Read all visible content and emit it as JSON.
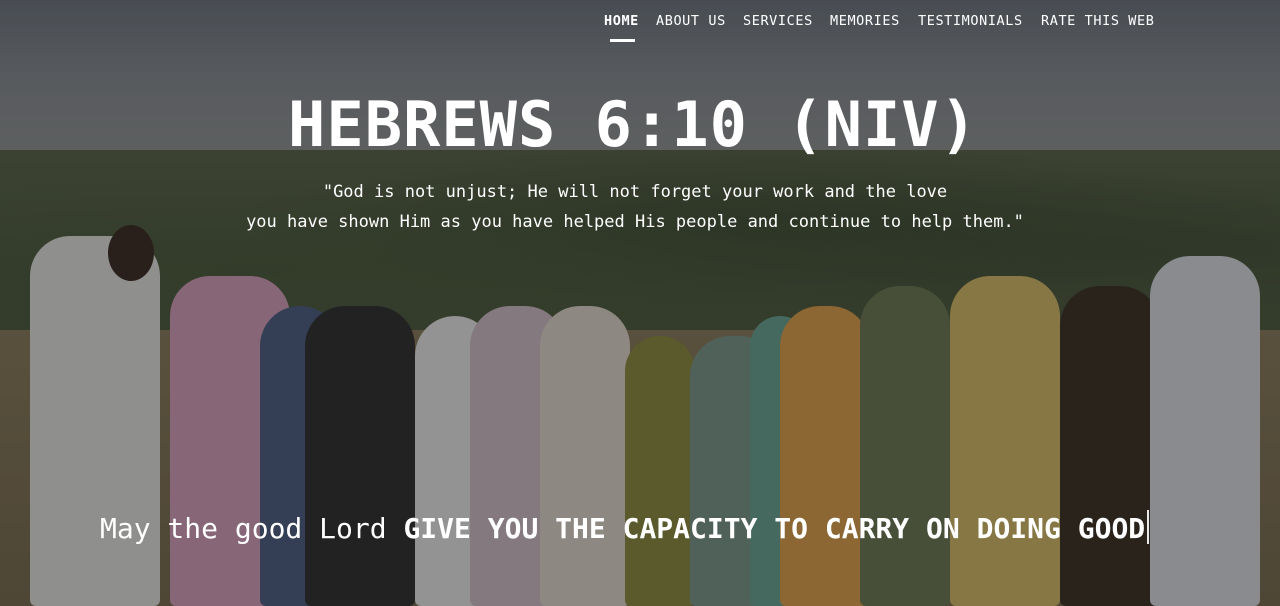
{
  "nav": {
    "items": [
      {
        "label": "HOME",
        "active": true
      },
      {
        "label": "ABOUT US",
        "active": false
      },
      {
        "label": "SERVICES",
        "active": false
      },
      {
        "label": "MEMORIES",
        "active": false
      },
      {
        "label": "TESTIMONIALS",
        "active": false
      },
      {
        "label": "RATE THIS WEB",
        "active": false
      }
    ]
  },
  "hero": {
    "title": "HEBREWS 6:10 (NIV)",
    "quote_line1": "\"God is not unjust; He will not forget your work and the love",
    "quote_line2": "you have shown Him as you have helped His people and continue to help them.\"",
    "tagline_lead": "May the good Lord",
    "tagline_emphasis": "GIVE YOU THE CAPACITY TO CARRY ON DOING GOOD",
    "background_image": "group-photo-outdoors"
  },
  "colors": {
    "text": "#ffffff",
    "overlay": "rgba(20,20,20,0.42)"
  }
}
